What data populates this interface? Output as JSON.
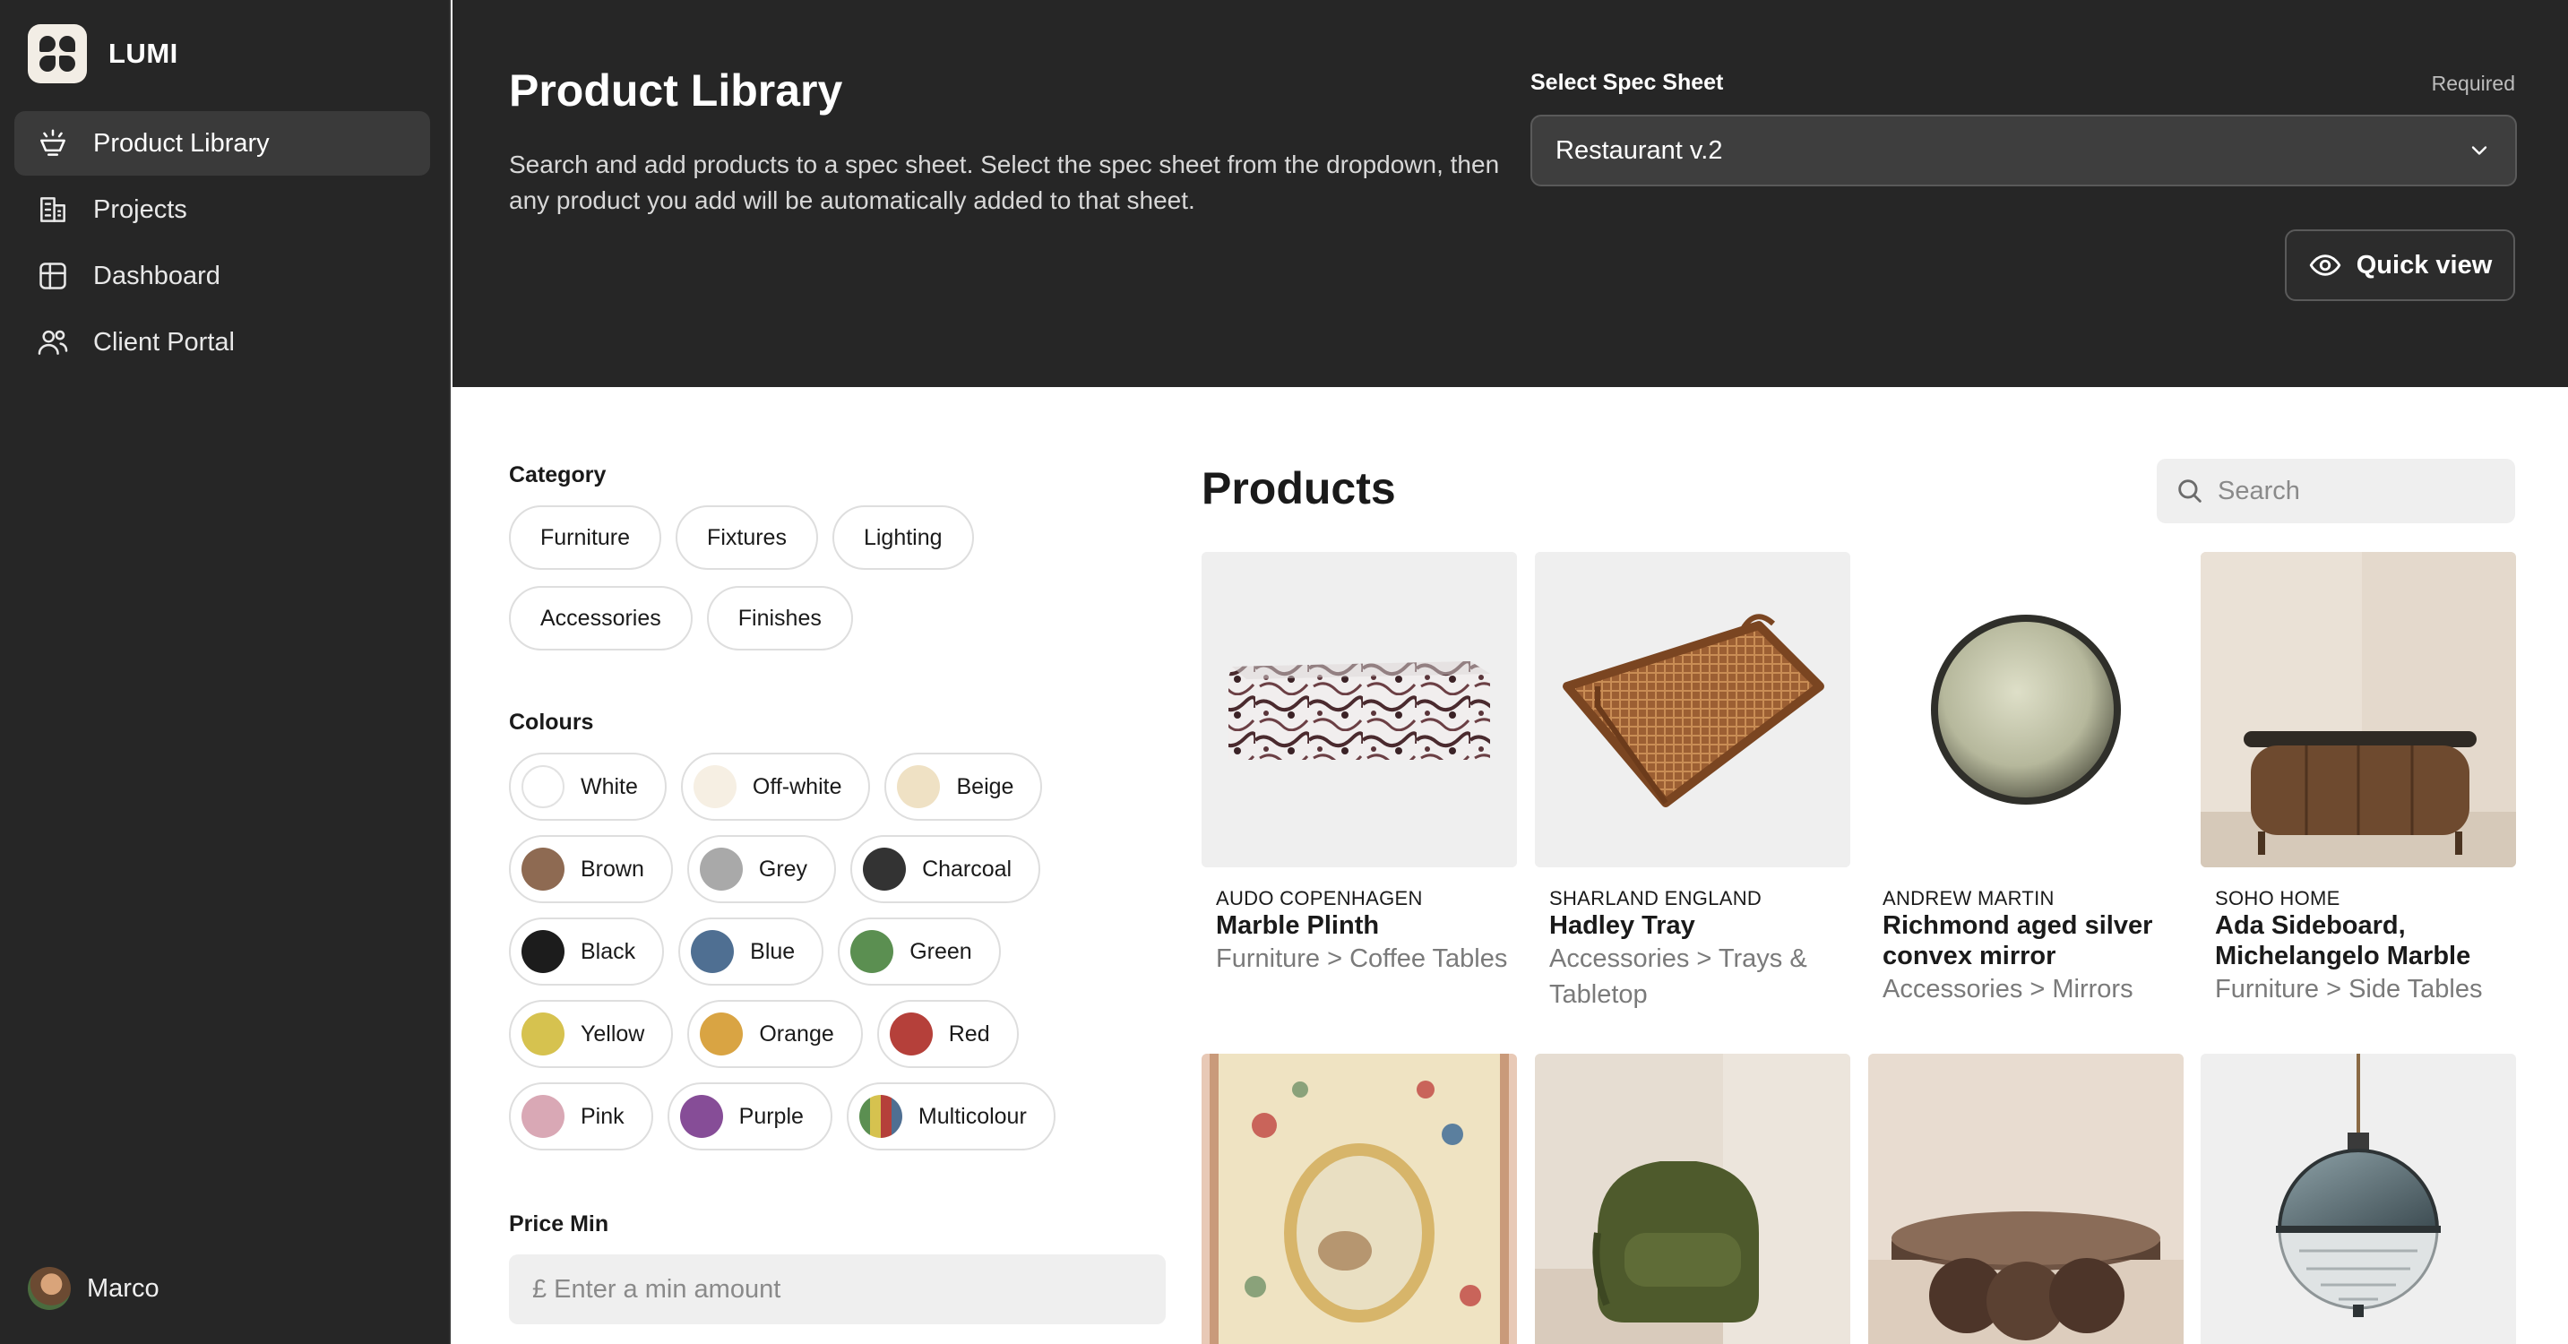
{
  "app": {
    "name": "LUMI"
  },
  "nav": [
    {
      "label": "Product Library",
      "icon": "lamp-icon",
      "active": true
    },
    {
      "label": "Projects",
      "icon": "building-icon",
      "active": false
    },
    {
      "label": "Dashboard",
      "icon": "grid-icon",
      "active": false
    },
    {
      "label": "Client Portal",
      "icon": "users-icon",
      "active": false
    }
  ],
  "user": {
    "name": "Marco"
  },
  "header": {
    "title": "Product Library",
    "description": "Search and add products to a spec sheet. Select the spec sheet from the dropdown, then any product you add will be automatically added to that sheet.",
    "spec_label": "Select Spec Sheet",
    "spec_required": "Required",
    "spec_value": "Restaurant v.2",
    "quick_view": "Quick view"
  },
  "filters": {
    "category_label": "Category",
    "categories": [
      "Furniture",
      "Fixtures",
      "Lighting",
      "Accessories",
      "Finishes"
    ],
    "colours_label": "Colours",
    "colours": [
      {
        "label": "White",
        "color": "#ffffff"
      },
      {
        "label": "Off-white",
        "color": "#f6efe3"
      },
      {
        "label": "Beige",
        "color": "#efe1c4"
      },
      {
        "label": "Brown",
        "color": "#8e6a52"
      },
      {
        "label": "Grey",
        "color": "#a9a9a9"
      },
      {
        "label": "Charcoal",
        "color": "#333333"
      },
      {
        "label": "Black",
        "color": "#1c1c1c"
      },
      {
        "label": "Blue",
        "color": "#4f6f92"
      },
      {
        "label": "Green",
        "color": "#5b8f51"
      },
      {
        "label": "Yellow",
        "color": "#d6c24f"
      },
      {
        "label": "Orange",
        "color": "#d9a443"
      },
      {
        "label": "Red",
        "color": "#b5403a"
      },
      {
        "label": "Pink",
        "color": "#d9a8b5"
      },
      {
        "label": "Purple",
        "color": "#864d97"
      },
      {
        "label": "Multicolour",
        "color": "multi"
      }
    ],
    "price_min_label": "Price Min",
    "price_min_placeholder": "£ Enter a min amount"
  },
  "products": {
    "title": "Products",
    "search_placeholder": "Search",
    "items": [
      {
        "brand": "AUDO COPENHAGEN",
        "name": "Marble Plinth",
        "category": "Furniture > Coffee Tables",
        "image": "marble-plinth"
      },
      {
        "brand": "SHARLAND ENGLAND",
        "name": "Hadley Tray",
        "category": "Accessories > Trays & Tabletop",
        "image": "rattan-tray"
      },
      {
        "brand": "ANDREW MARTIN",
        "name": "Richmond aged silver convex mirror",
        "category": "Accessories > Mirrors",
        "image": "round-mirror"
      },
      {
        "brand": "SOHO HOME",
        "name": "Ada Sideboard, Michelangelo Marble",
        "category": "Furniture > Side Tables",
        "image": "sideboard"
      },
      {
        "image": "tapestry-rug"
      },
      {
        "image": "green-armchair"
      },
      {
        "image": "marble-coffee-table"
      },
      {
        "image": "glass-pendant-lamp"
      }
    ]
  }
}
